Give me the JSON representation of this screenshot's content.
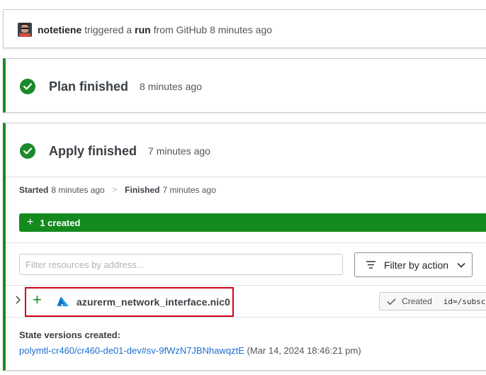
{
  "trigger": {
    "user": "notetiene",
    "text_triggered": "triggered a",
    "run_word": "run",
    "text_from": "from GitHub 8 minutes ago"
  },
  "plan": {
    "title": "Plan finished",
    "time": "8 minutes ago"
  },
  "apply": {
    "title": "Apply finished",
    "time": "7 minutes ago",
    "started_label": "Started",
    "started_time": "8 minutes ago",
    "separator": ">",
    "finished_label": "Finished",
    "finished_time": "7 minutes ago",
    "created_count_label": "1 created",
    "filter_placeholder": "Filter resources by address...",
    "filter_action_label": "Filter by action",
    "resource": {
      "name": "azurerm_network_interface.nic0",
      "status": "Created",
      "id": "id=/subscr"
    },
    "state_title": "State versions created:",
    "state_link": "polymtl-cr460/cr460-de01-dev#sv-9fWzN7JBNhawqztE",
    "state_date": "(Mar 14, 2024 18:46:21 pm)"
  },
  "colors": {
    "success": "#1a8a2a",
    "created_bar": "#138a1e",
    "link": "#1a6fd1",
    "highlight": "#d0021b",
    "azure": "#0078d4"
  },
  "icons": [
    "avatar",
    "check-circle-icon",
    "plus-icon",
    "filter-lines-icon",
    "chevron-down-icon",
    "chevron-right-icon",
    "azure-icon",
    "checkmark-icon"
  ]
}
